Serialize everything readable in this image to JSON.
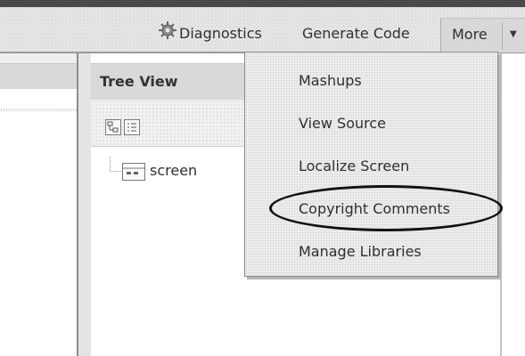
{
  "toolbar": {
    "diagnostics_label": "Diagnostics",
    "diagnostics_icon": "gear-bug-icon",
    "generate_code_label": "Generate Code",
    "more_label": "More",
    "more_arrow_icon": "caret-down-icon"
  },
  "tree_view": {
    "title": "Tree View",
    "toolbar_icons": [
      "expand-all-icon",
      "list-icon"
    ],
    "nodes": [
      {
        "label": "screen",
        "icon": "screen-node-icon"
      }
    ]
  },
  "more_menu": {
    "items": [
      {
        "label": "Mashups"
      },
      {
        "label": "View Source"
      },
      {
        "label": "Localize Screen"
      },
      {
        "label": "Copyright Comments",
        "highlighted": true
      },
      {
        "label": "Manage Libraries"
      }
    ]
  },
  "colors": {
    "toolbar_bg": "#e9e9e9",
    "menu_bg": "#efefef",
    "highlight_ellipse": "#111111"
  }
}
